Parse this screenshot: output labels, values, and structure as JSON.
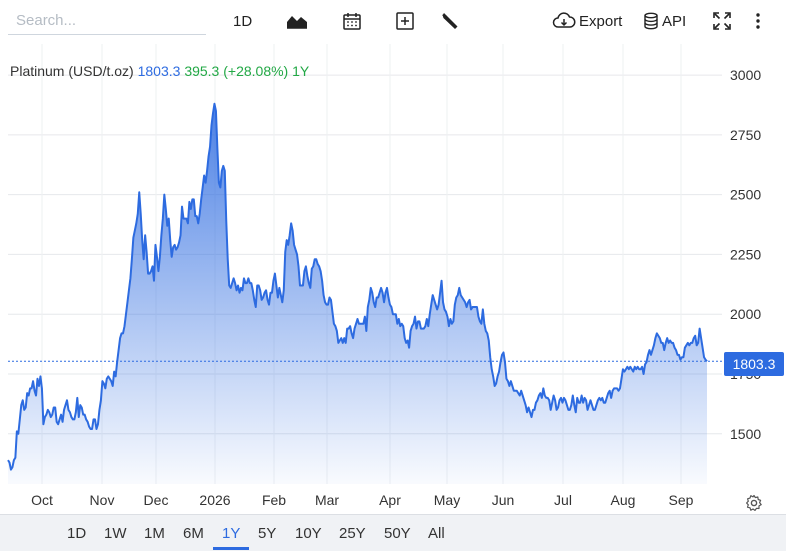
{
  "toolbar": {
    "search_placeholder": "Search...",
    "interval_label": "1D",
    "export_label": "Export",
    "api_label": "API"
  },
  "legend": {
    "name": "Platinum (USD/t.oz)",
    "price": "1803.3",
    "change": "395.3 (+28.08%)",
    "period": "1Y"
  },
  "price_tag": "1803.3",
  "ranges": [
    {
      "label": "1D",
      "active": false
    },
    {
      "label": "1W",
      "active": false
    },
    {
      "label": "1M",
      "active": false
    },
    {
      "label": "6M",
      "active": false
    },
    {
      "label": "1Y",
      "active": true
    },
    {
      "label": "5Y",
      "active": false
    },
    {
      "label": "10Y",
      "active": false
    },
    {
      "label": "25Y",
      "active": false
    },
    {
      "label": "50Y",
      "active": false
    },
    {
      "label": "All",
      "active": false
    }
  ],
  "colors": {
    "line": "#2d6be0",
    "accent": "#2d6be0",
    "change": "#22a845"
  },
  "chart_data": {
    "type": "area",
    "yaxis_ticks": [
      1500,
      1750,
      2000,
      2250,
      2500,
      2750,
      3000
    ],
    "ylim": [
      1290,
      3130
    ],
    "xaxis_ticks": [
      "Oct",
      "Nov",
      "Dec",
      "2026",
      "Feb",
      "Mar",
      "Apr",
      "May",
      "Jun",
      "Jul",
      "Aug",
      "Sep"
    ],
    "grid": true,
    "last_value": 1803.3,
    "series": [
      {
        "values": [
          1390,
          1380,
          1350,
          1360,
          1390,
          1400,
          1510,
          1500,
          1560,
          1620,
          1640,
          1600,
          1610,
          1670,
          1660,
          1690,
          1690,
          1720,
          1680,
          1660,
          1730,
          1700,
          1740,
          1690,
          1540,
          1570,
          1580,
          1600,
          1590,
          1570,
          1580,
          1610,
          1610,
          1550,
          1540,
          1560,
          1580,
          1550,
          1600,
          1620,
          1640,
          1600,
          1590,
          1570,
          1560,
          1560,
          1590,
          1650,
          1570,
          1620,
          1610,
          1580,
          1580,
          1560,
          1550,
          1530,
          1520,
          1520,
          1560,
          1560,
          1520,
          1540,
          1600,
          1640,
          1720,
          1710,
          1690,
          1730,
          1740,
          1730,
          1720,
          1700,
          1760,
          1740,
          1800,
          1850,
          1900,
          1920,
          1920,
          1950,
          2000,
          2050,
          2100,
          2150,
          2230,
          2320,
          2350,
          2380,
          2420,
          2510,
          2420,
          2310,
          2230,
          2330,
          2260,
          2170,
          2170,
          2180,
          2200,
          2140,
          2290,
          2240,
          2180,
          2240,
          2330,
          2400,
          2500,
          2440,
          2370,
          2400,
          2310,
          2240,
          2280,
          2290,
          2270,
          2280,
          2300,
          2330,
          2450,
          2400,
          2400,
          2400,
          2380,
          2470,
          2440,
          2480,
          2480,
          2410,
          2410,
          2380,
          2420,
          2480,
          2530,
          2580,
          2550,
          2600,
          2660,
          2700,
          2790,
          2840,
          2880,
          2850,
          2690,
          2550,
          2530,
          2600,
          2620,
          2600,
          2390,
          2230,
          2120,
          2110,
          2130,
          2150,
          2130,
          2100,
          2120,
          2090,
          2110,
          2100,
          2150,
          2130,
          2130,
          2150,
          2130,
          2130,
          2100,
          2060,
          2030,
          2120,
          2120,
          2100,
          2060,
          2070,
          2090,
          2100,
          2060,
          2040,
          2090,
          2090,
          2140,
          2170,
          2120,
          2070,
          2110,
          2080,
          2050,
          2100,
          2260,
          2310,
          2290,
          2330,
          2380,
          2350,
          2290,
          2270,
          2250,
          2200,
          2120,
          2120,
          2120,
          2180,
          2200,
          2160,
          2130,
          2110,
          2190,
          2200,
          2230,
          2230,
          2210,
          2200,
          2180,
          2140,
          2080,
          2050,
          2040,
          2040,
          2070,
          2060,
          2010,
          1960,
          1950,
          1930,
          1880,
          1890,
          1900,
          1880,
          1900,
          1880,
          1940,
          1940,
          1950,
          1920,
          1900,
          1940,
          1960,
          1980,
          1960,
          1960,
          1960,
          1960,
          1990,
          1930,
          2030,
          2060,
          2110,
          2090,
          2050,
          2030,
          2070,
          2070,
          2090,
          2110,
          2090,
          2050,
          2090,
          2110,
          2070,
          2040,
          2030,
          2000,
          2000,
          2000,
          1960,
          1980,
          1950,
          1960,
          1950,
          1900,
          1880,
          1890,
          1860,
          1930,
          1950,
          1960,
          1990,
          1940,
          1970,
          1970,
          1940,
          1940,
          1940,
          1950,
          1980,
          1950,
          2000,
          2040,
          2080,
          2060,
          2040,
          2020,
          2040,
          2090,
          2140,
          2050,
          2020,
          2010,
          1990,
          1950,
          1980,
          1960,
          1970,
          2040,
          2070,
          2080,
          2110,
          2080,
          2070,
          2060,
          2050,
          2030,
          2050,
          2060,
          2020,
          2030,
          2030,
          2030,
          2030,
          1990,
          1970,
          1960,
          2020,
          1960,
          1930,
          1920,
          1890,
          1820,
          1770,
          1740,
          1700,
          1710,
          1740,
          1760,
          1800,
          1830,
          1840,
          1800,
          1730,
          1720,
          1700,
          1720,
          1700,
          1680,
          1680,
          1680,
          1670,
          1660,
          1680,
          1660,
          1640,
          1620,
          1590,
          1610,
          1590,
          1570,
          1600,
          1600,
          1630,
          1640,
          1660,
          1670,
          1650,
          1690,
          1660,
          1650,
          1650,
          1640,
          1600,
          1630,
          1660,
          1640,
          1600,
          1610,
          1640,
          1650,
          1630,
          1650,
          1640,
          1620,
          1600,
          1600,
          1620,
          1660,
          1620,
          1590,
          1650,
          1630,
          1630,
          1660,
          1630,
          1650,
          1640,
          1600,
          1620,
          1640,
          1620,
          1600,
          1600,
          1620,
          1640,
          1650,
          1640,
          1650,
          1630,
          1630,
          1650,
          1670,
          1680,
          1650,
          1680,
          1690,
          1690,
          1690,
          1680,
          1690,
          1730,
          1770,
          1760,
          1770,
          1780,
          1770,
          1780,
          1770,
          1760,
          1780,
          1770,
          1780,
          1770,
          1770,
          1780,
          1750,
          1790,
          1800,
          1830,
          1850,
          1830,
          1850,
          1870,
          1900,
          1920,
          1910,
          1900,
          1880,
          1880,
          1850,
          1880,
          1900,
          1880,
          1890,
          1880,
          1880,
          1860,
          1850,
          1830,
          1830,
          1810,
          1820,
          1820,
          1860,
          1870,
          1880,
          1870,
          1880,
          1880,
          1900,
          1910,
          1870,
          1880,
          1940,
          1900,
          1860,
          1820,
          1810,
          1803.3
        ]
      }
    ]
  }
}
